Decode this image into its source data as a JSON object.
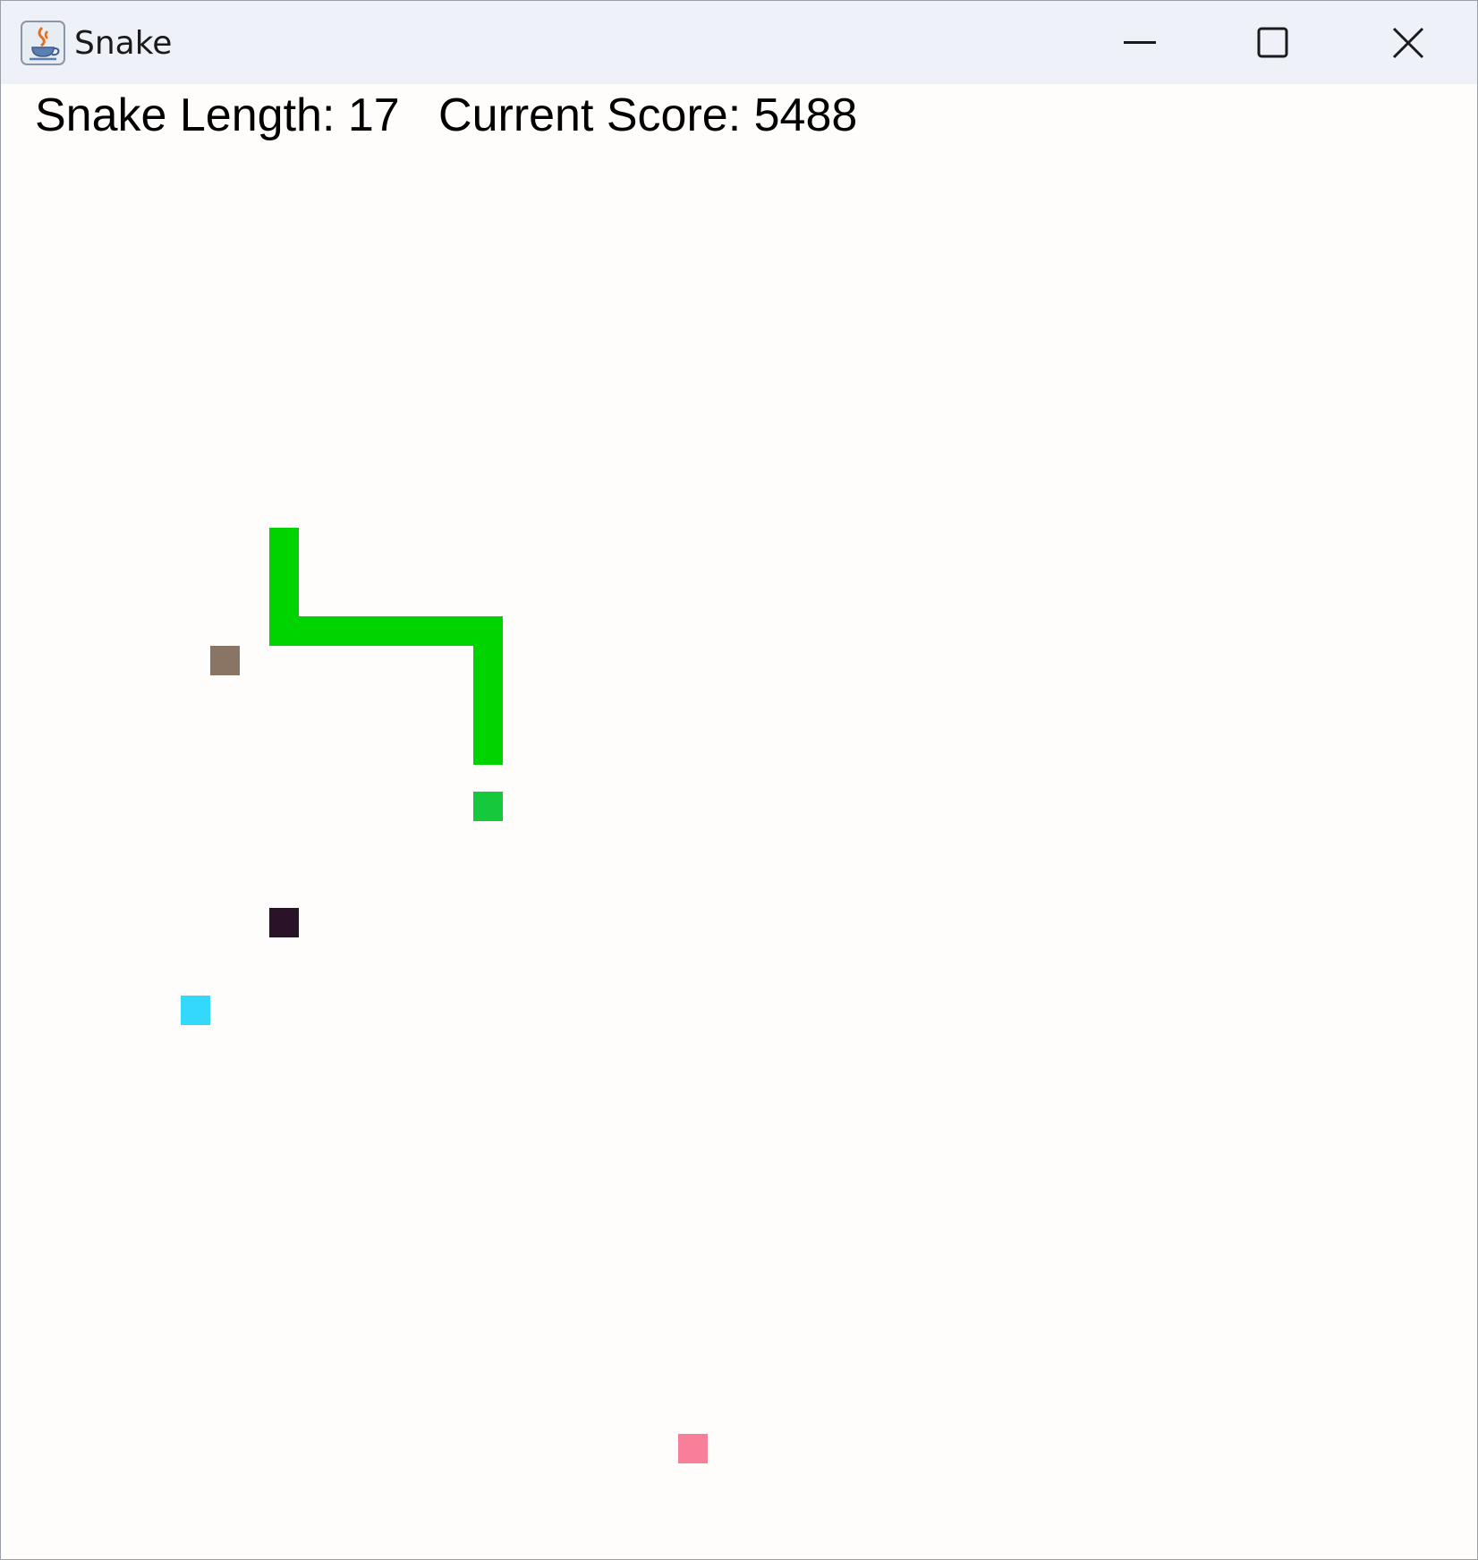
{
  "window": {
    "title": "Snake",
    "icon": "java-coffee-cup-icon",
    "controls": [
      "minimize-icon",
      "maximize-icon",
      "close-icon"
    ]
  },
  "hud": {
    "length_label": "Snake Length: ",
    "length_value": "17",
    "score_label": "Current Score: ",
    "score_value": "5488"
  },
  "colors": {
    "snake_body": "#00d400",
    "snake_head": "#16c83c",
    "food_brown": "#8a7565",
    "food_dark": "#2a1228",
    "food_cyan": "#33d9fb",
    "food_pink": "#f77f9a",
    "background": "#fffdfc"
  }
}
